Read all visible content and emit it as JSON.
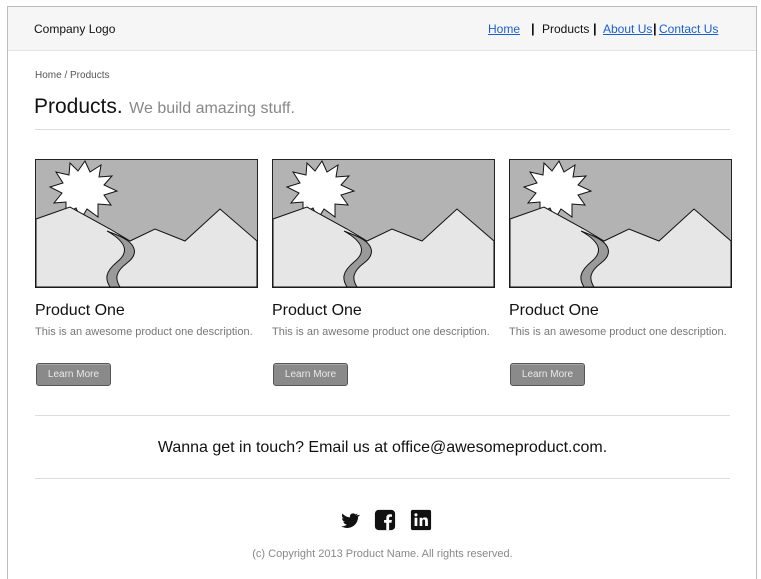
{
  "header": {
    "logo": "Company Logo",
    "nav": [
      {
        "label": "Home",
        "link": true
      },
      {
        "label": "Products",
        "link": false
      },
      {
        "label": "About Us",
        "link": true
      },
      {
        "label": "Contact Us",
        "link": true
      }
    ]
  },
  "breadcrumb": "Home / Products",
  "page": {
    "title": "Products.",
    "subtitle": "We build amazing stuff."
  },
  "products": [
    {
      "name": "Product One",
      "description": "This is an awesome product one description.",
      "button": "Learn More"
    },
    {
      "name": "Product One",
      "description": "This is an awesome product one description.",
      "button": "Learn More"
    },
    {
      "name": "Product One",
      "description": "This is an awesome product one description.",
      "button": "Learn More"
    }
  ],
  "contact": "Wanna get in touch? Email us at office@awesomeproduct.com.",
  "social": [
    "twitter-icon",
    "facebook-icon",
    "linkedin-icon"
  ],
  "footer": {
    "copyright": "(c) Copyright 2013 Product Name. All rights reserved."
  },
  "colors": {
    "link": "#1a5fd0",
    "button": "#8a8a8a",
    "header_bg": "#f6f6f6"
  }
}
